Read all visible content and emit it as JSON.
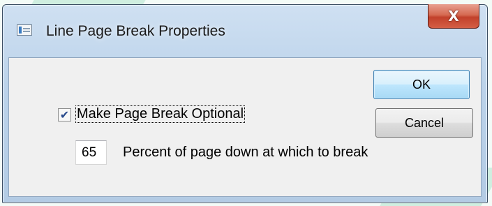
{
  "window": {
    "title": "Line Page Break Properties",
    "close_icon": "close-x-icon",
    "close_glyph": "X"
  },
  "buttons": {
    "ok_label": "OK",
    "cancel_label": "Cancel"
  },
  "options": {
    "optional_checked": true,
    "optional_label": "Make Page Break Optional",
    "check_glyph": "✔",
    "percent_value": "65",
    "percent_label": "Percent of page down at which to break"
  },
  "colors": {
    "close_button": "#c2412b",
    "ok_border": "#3c7fb1",
    "dialog_face": "#f0f0f0"
  }
}
